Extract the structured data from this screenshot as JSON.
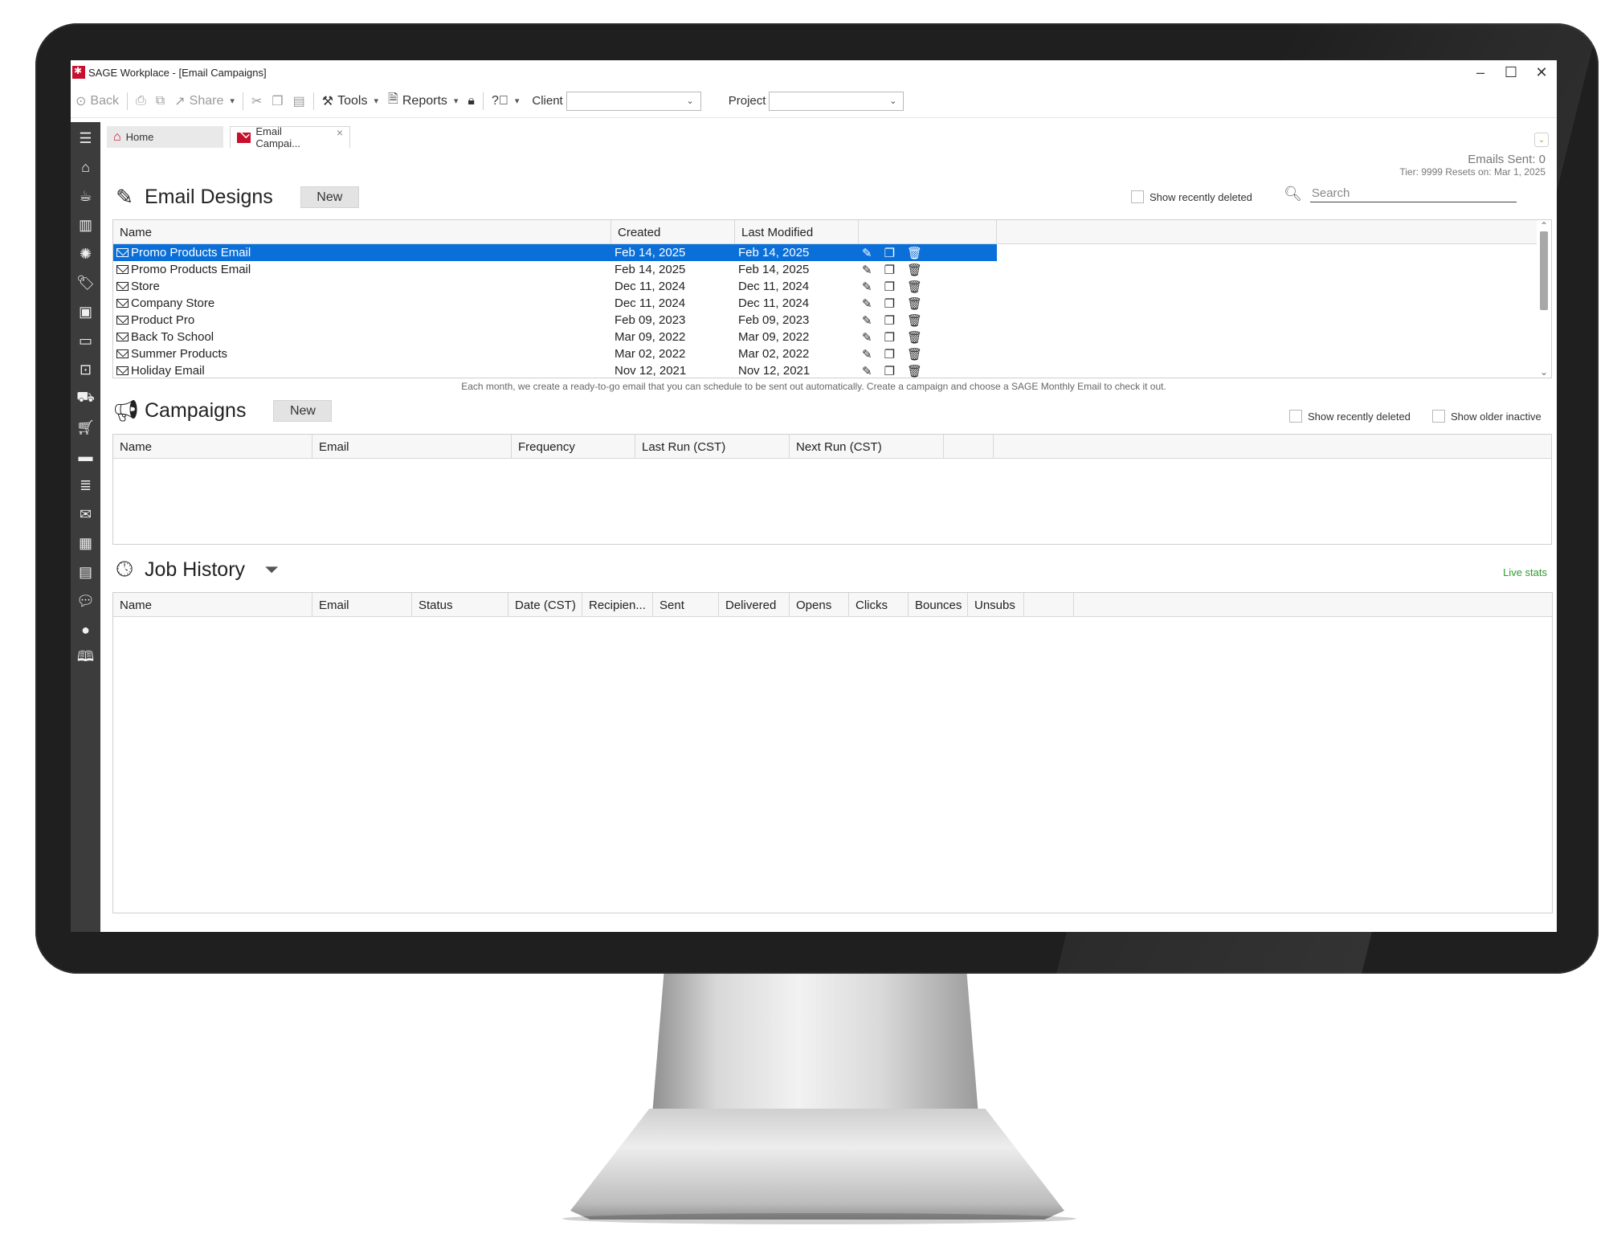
{
  "window": {
    "title": "SAGE Workplace - [Email Campaigns]",
    "minimize": "–",
    "maximize": "☐",
    "close": "✕"
  },
  "toolbar": {
    "back": "Back",
    "share": "Share",
    "tools": "Tools",
    "reports": "Reports",
    "client_label": "Client",
    "client_value": "",
    "project_label": "Project",
    "project_value": ""
  },
  "sidebar_icons": [
    "menu-icon",
    "home-icon",
    "coffee-icon",
    "building-icon",
    "palette-icon",
    "tag-icon",
    "id-card-icon",
    "briefcase-icon",
    "presentation-icon",
    "truck-icon",
    "cart-icon",
    "credit-card-icon",
    "database-icon",
    "mail-icon",
    "calculator-icon",
    "calendar-icon",
    "chat-icon",
    "comment-icon",
    "book-icon"
  ],
  "tabs": {
    "home": "Home",
    "email_campaigns": "Email Campai...",
    "close": "×"
  },
  "stats": {
    "emails_sent": "Emails Sent: 0",
    "tier_resets": "Tier: 9999  Resets on: Mar 1, 2025"
  },
  "email_designs": {
    "title": "Email Designs",
    "new_label": "New",
    "show_deleted_label": "Show recently deleted",
    "search_placeholder": "Search",
    "columns": [
      "Name",
      "Created",
      "Last Modified"
    ],
    "rows": [
      {
        "name": "Promo Products Email",
        "created": "Feb 14, 2025",
        "modified": "Feb 14, 2025",
        "selected": true
      },
      {
        "name": "Promo Products Email",
        "created": "Feb 14, 2025",
        "modified": "Feb 14, 2025",
        "selected": false
      },
      {
        "name": "Store",
        "created": "Dec 11, 2024",
        "modified": "Dec 11, 2024",
        "selected": false
      },
      {
        "name": "Company Store",
        "created": "Dec 11, 2024",
        "modified": "Dec 11, 2024",
        "selected": false
      },
      {
        "name": "Product Pro",
        "created": "Feb 09, 2023",
        "modified": "Feb 09, 2023",
        "selected": false
      },
      {
        "name": "Back To School",
        "created": "Mar 09, 2022",
        "modified": "Mar 09, 2022",
        "selected": false
      },
      {
        "name": "Summer Products",
        "created": "Mar 02, 2022",
        "modified": "Mar 02, 2022",
        "selected": false
      },
      {
        "name": "Holiday Email",
        "created": "Nov 12, 2021",
        "modified": "Nov 12, 2021",
        "selected": false
      }
    ],
    "hint": "Each month, we create a ready-to-go email that you can schedule to be sent out automatically.  Create a campaign and choose a SAGE Monthly Email to check it out."
  },
  "campaigns": {
    "title": "Campaigns",
    "new_label": "New",
    "show_deleted_label": "Show recently deleted",
    "show_older_label": "Show older inactive",
    "columns": [
      "Name",
      "Email",
      "Frequency",
      "Last Run (CST)",
      "Next Run (CST)"
    ]
  },
  "job_history": {
    "title": "Job History",
    "live_stats": "Live stats",
    "columns": [
      "Name",
      "Email",
      "Status",
      "Date (CST)",
      "Recipien...",
      "Sent",
      "Delivered",
      "Opens",
      "Clicks",
      "Bounces",
      "Unsubs"
    ]
  },
  "colors": {
    "selection": "#0a6fd8",
    "brand_red": "#c8102e",
    "live_stats_green": "#2e9a2e",
    "sidebar": "#3c3c3c"
  }
}
